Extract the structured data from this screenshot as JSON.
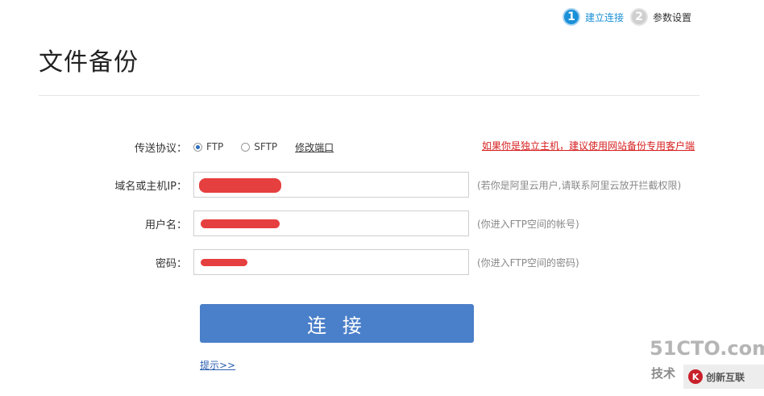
{
  "steps": [
    {
      "number": "1",
      "label": "建立连接",
      "active": true
    },
    {
      "number": "2",
      "label": "参数设置",
      "active": false
    }
  ],
  "page_title": "文件备份",
  "form": {
    "protocol": {
      "label": "传送协议：",
      "options": [
        "FTP",
        "SFTP"
      ],
      "selected": "FTP",
      "modify_port_label": "修改端口",
      "red_notice": "如果你是独立主机，建议使用网站备份专用客户端"
    },
    "host": {
      "label": "域名或主机IP：",
      "value": "",
      "hint": "(若你是阿里云用户,请联系阿里云放开拦截权限)"
    },
    "username": {
      "label": "用户名：",
      "value": "",
      "hint": "(你进入FTP空间的帐号)"
    },
    "password": {
      "label": "密码：",
      "value": "",
      "hint": "(你进入FTP空间的密码)"
    },
    "connect_button": "连 接",
    "tips_link": "提示>>"
  },
  "watermark": {
    "site": "51CTO.com",
    "tech": "技术",
    "brand": "创新互联",
    "brand_logo": "K"
  },
  "colors": {
    "accent": "#1a90d8",
    "button": "#4a7fc9",
    "notice": "#d71f1f"
  }
}
